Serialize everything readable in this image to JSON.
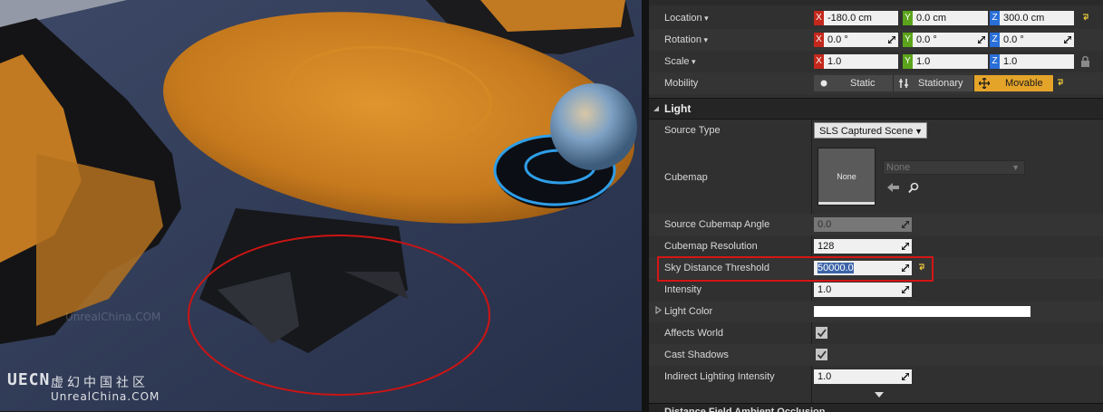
{
  "transform": {
    "location": {
      "label": "Location",
      "x": "-180.0 cm",
      "y": "0.0 cm",
      "z": "300.0 cm"
    },
    "rotation": {
      "label": "Rotation",
      "x": "0.0 °",
      "y": "0.0 °",
      "z": "0.0 °"
    },
    "scale": {
      "label": "Scale",
      "x": "1.0",
      "y": "1.0",
      "z": "1.0"
    },
    "mobility": {
      "label": "Mobility",
      "options": [
        "Static",
        "Stationary",
        "Movable"
      ],
      "selected": "Movable"
    }
  },
  "light": {
    "header": "Light",
    "source_type": {
      "label": "Source Type",
      "value": "SLS Captured Scene"
    },
    "cubemap": {
      "label": "Cubemap",
      "thumb_label": "None",
      "asset": "None"
    },
    "source_cubemap_angle": {
      "label": "Source Cubemap Angle",
      "value": "0.0"
    },
    "cubemap_resolution": {
      "label": "Cubemap Resolution",
      "value": "128"
    },
    "sky_distance_threshold": {
      "label": "Sky Distance Threshold",
      "value": "50000.0"
    },
    "intensity": {
      "label": "Intensity",
      "value": "1.0"
    },
    "light_color": {
      "label": "Light Color",
      "color": "#ffffff"
    },
    "affects_world": {
      "label": "Affects World",
      "checked": true
    },
    "cast_shadows": {
      "label": "Cast Shadows",
      "checked": true
    },
    "indirect_lighting_intensity": {
      "label": "Indirect Lighting Intensity",
      "value": "1.0"
    },
    "next_section": "Distance Field Ambient Occlusion"
  },
  "watermark": {
    "logo": "UECN",
    "chinese": "虚幻中国社区",
    "site": "UnrealChina.COM",
    "faint": "UnrealChina.COM"
  },
  "colors": {
    "axis_x": "#c4281c",
    "axis_y": "#5ba41b",
    "axis_z": "#2a6fd8",
    "mobility_active": "#e4a42a",
    "highlight": "#d61515"
  }
}
